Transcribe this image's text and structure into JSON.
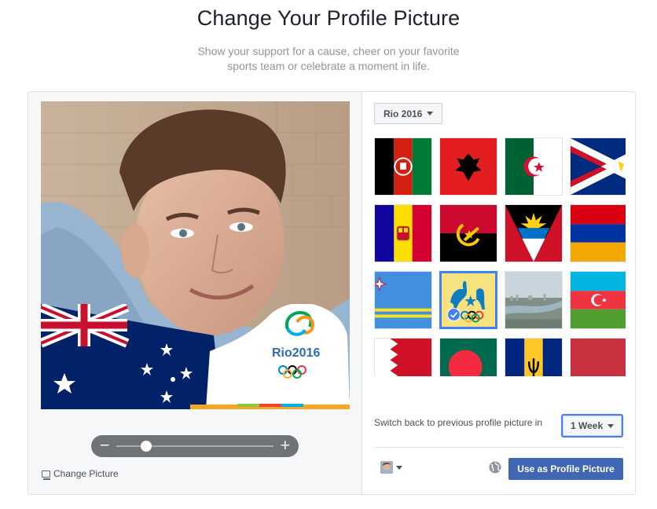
{
  "header": {
    "title": "Change Your Profile Picture",
    "subtitle_line1": "Show your support for a cause, cheer on your favorite",
    "subtitle_line2": "sports team or celebrate a moment in life."
  },
  "preview": {
    "overlay_logo_text": "Rio2016",
    "zoom_minus": "−",
    "zoom_plus": "+",
    "zoom_level": 0.19,
    "change_picture_label": "Change Picture"
  },
  "frames": {
    "category_label": "Rio 2016",
    "items": [
      {
        "name": "afghanistan",
        "selected": false
      },
      {
        "name": "albania",
        "selected": false
      },
      {
        "name": "algeria",
        "selected": false
      },
      {
        "name": "american-samoa",
        "selected": false
      },
      {
        "name": "andorra",
        "selected": false
      },
      {
        "name": "angola",
        "selected": false
      },
      {
        "name": "antigua-and-barbuda",
        "selected": false
      },
      {
        "name": "armenia",
        "selected": false
      },
      {
        "name": "aruba",
        "selected": false
      },
      {
        "name": "australia",
        "selected": true
      },
      {
        "name": "austria",
        "selected": false
      },
      {
        "name": "azerbaijan",
        "selected": false
      },
      {
        "name": "bahrain",
        "selected": false
      },
      {
        "name": "bangladesh",
        "selected": false
      },
      {
        "name": "barbados",
        "selected": false
      },
      {
        "name": "belarus",
        "selected": false
      }
    ]
  },
  "footer": {
    "switch_back_label": "Switch back to previous profile picture in",
    "duration_value": "1 Week",
    "use_button_label": "Use as Profile Picture"
  },
  "colors": {
    "accent": "#4080ff",
    "primary_button": "#4267b2"
  }
}
